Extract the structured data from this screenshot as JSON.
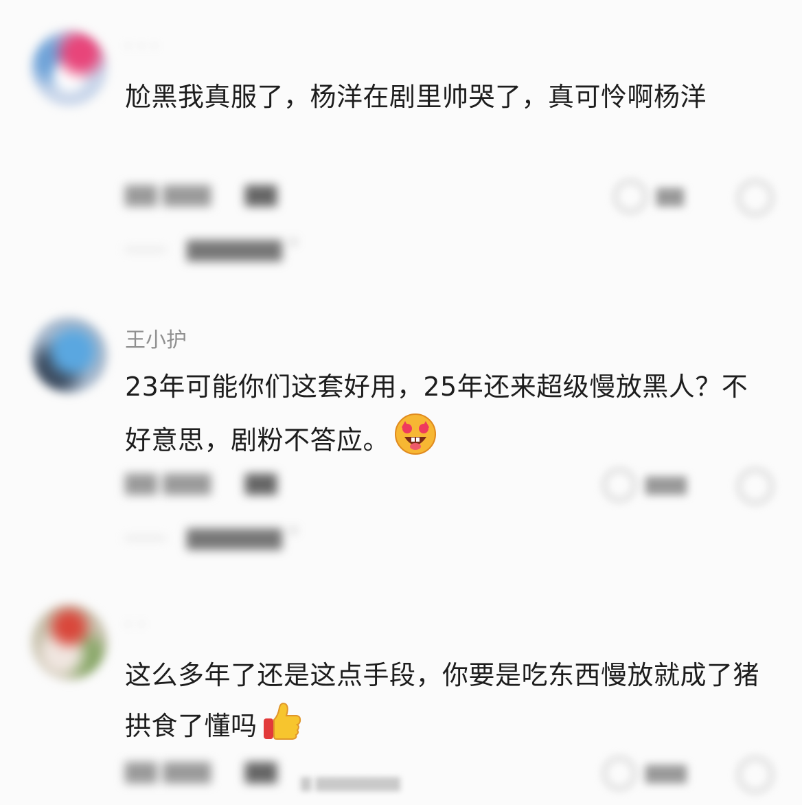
{
  "comments": [
    {
      "username": "",
      "text": "尬黑我真服了，杨洋在剧里帅哭了，真可怜啊杨洋",
      "emoji": "",
      "avatar_icon": "avatar-image",
      "meta": {
        "date": "",
        "reply_label": "",
        "like_count": ""
      },
      "expand_label": ""
    },
    {
      "username": "王小护",
      "text": "23年可能你们这套好用，25年还来超级慢放黑人？不好意思，剧粉不答应。",
      "emoji": "star-struck-emoji",
      "avatar_icon": "avatar-image",
      "meta": {
        "date": "",
        "reply_label": "",
        "like_count": ""
      },
      "expand_label": ""
    },
    {
      "username": "",
      "text": "这么多年了还是这点手段，你要是吃东西慢放就成了猪拱食了懂吗",
      "emoji": "thumbs-up-emoji",
      "avatar_icon": "avatar-image",
      "meta": {
        "date": "",
        "reply_label": "",
        "like_count": ""
      },
      "expand_label": ""
    }
  ]
}
